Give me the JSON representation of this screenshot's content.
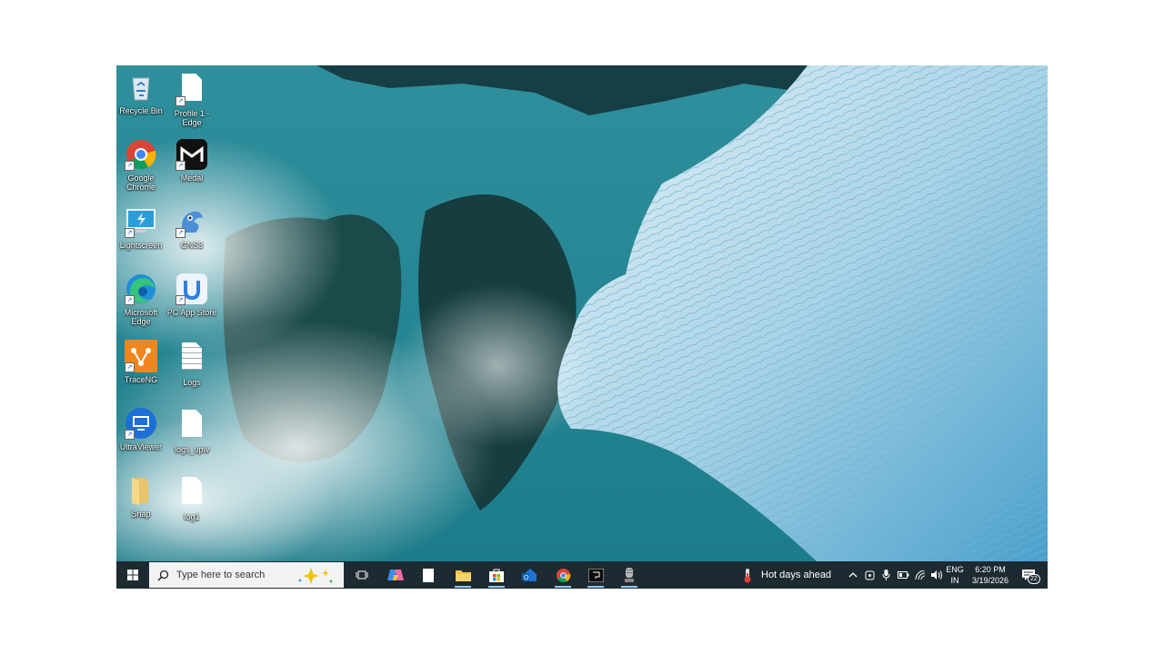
{
  "desktop": {
    "icons": [
      {
        "label": "Recycle Bin",
        "icon": "recycle-bin-icon"
      },
      {
        "label": "Profile 1 - Edge",
        "icon": "document-icon"
      },
      {
        "label": "Google Chrome",
        "icon": "chrome-icon"
      },
      {
        "label": "Medal",
        "icon": "medal-icon"
      },
      {
        "label": "Lightscreen",
        "icon": "lightscreen-icon"
      },
      {
        "label": "GNS3",
        "icon": "gns3-icon"
      },
      {
        "label": "Microsoft Edge",
        "icon": "edge-icon"
      },
      {
        "label": "PC App Store",
        "icon": "app-store-icon"
      },
      {
        "label": "TraceNG",
        "icon": "traceng-icon"
      },
      {
        "label": "Logs",
        "icon": "text-document-icon"
      },
      {
        "label": "UltraViewer",
        "icon": "ultraviewer-icon"
      },
      {
        "label": "logs_upw",
        "icon": "document-icon"
      },
      {
        "label": "Snap",
        "icon": "folder-icon"
      },
      {
        "label": "log1",
        "icon": "document-icon"
      }
    ]
  },
  "taskbar": {
    "search_placeholder": "Type here to search",
    "pinned": [
      "task-view-icon",
      "copilot-icon",
      "notepad-icon",
      "file-explorer-icon",
      "microsoft-store-icon",
      "outlook-icon",
      "chrome-icon",
      "terminal-icon",
      "microphone-app-icon"
    ],
    "weather_text": "Hot days ahead",
    "language_line1": "ENG",
    "language_line2": "IN",
    "time": "6:20 PM",
    "date": "3/19/2026",
    "notification_count": "22"
  },
  "colors": {
    "taskbar": "#1d2a31",
    "accent_underline": "#8ec8f0"
  }
}
